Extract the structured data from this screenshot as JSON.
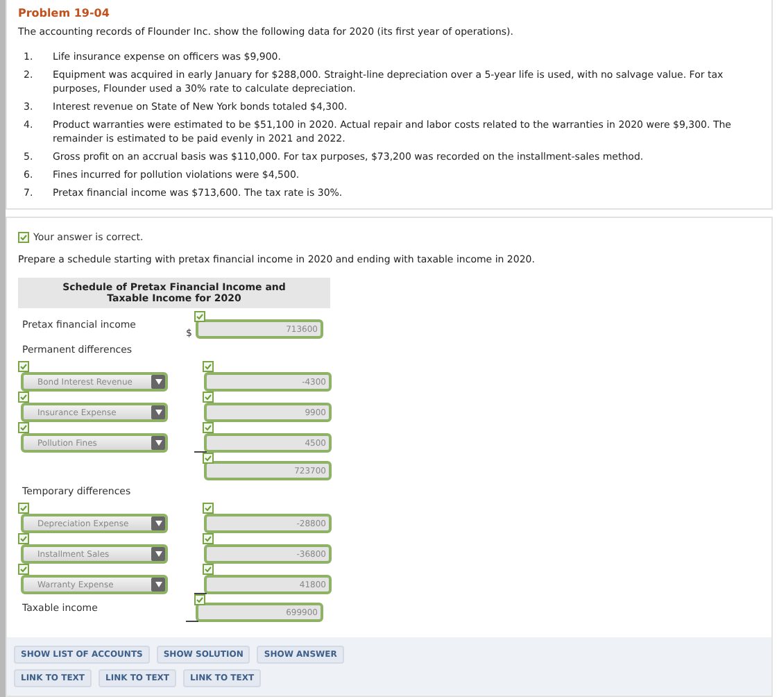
{
  "problem": {
    "title": "Problem 19-04",
    "intro": "The accounting records of Flounder Inc. show the following data for 2020 (its first year of operations).",
    "items": [
      {
        "number": "1.",
        "text": "Life insurance expense on officers was $9,900."
      },
      {
        "number": "2.",
        "text": "Equipment was acquired in early January for $288,000. Straight-line depreciation over a 5-year life is used, with no salvage value. For tax purposes, Flounder used a 30% rate to calculate depreciation."
      },
      {
        "number": "3.",
        "text": "Interest revenue on State of New York bonds totaled $4,300."
      },
      {
        "number": "4.",
        "text": "Product warranties were estimated to be $51,100 in 2020. Actual repair and labor costs related to the warranties in 2020 were $9,300. The remainder is estimated to be paid evenly in 2021 and 2022."
      },
      {
        "number": "5.",
        "text": "Gross profit on an accrual basis was $110,000. For tax purposes, $73,200 was recorded on the installment-sales method."
      },
      {
        "number": "6.",
        "text": "Fines incurred for pollution violations were $4,500."
      },
      {
        "number": "7.",
        "text": "Pretax financial income was $713,600. The tax rate is 30%."
      }
    ]
  },
  "answer": {
    "correct": true,
    "status": "Your answer is correct.",
    "instruction": "Prepare a schedule starting with pretax financial income in 2020 and ending with taxable income in 2020.",
    "schedule_title": "Schedule of Pretax Financial Income and Taxable Income for 2020",
    "rows": [
      {
        "kind": "total",
        "label": "Pretax financial income",
        "currency": "$",
        "amount": "713600",
        "correct": true,
        "underlined": false
      },
      {
        "kind": "heading",
        "label": "Permanent differences"
      },
      {
        "kind": "account",
        "account": "Bond Interest Revenue",
        "account_correct": true,
        "amount": "-4300",
        "correct": true,
        "underlined": false
      },
      {
        "kind": "account",
        "account": "Insurance Expense",
        "account_correct": true,
        "amount": "9900",
        "correct": true,
        "underlined": false
      },
      {
        "kind": "account",
        "account": "Pollution Fines",
        "account_correct": true,
        "amount": "4500",
        "correct": true,
        "underlined": true
      },
      {
        "kind": "subtotal",
        "amount": "723700",
        "correct": true,
        "underlined": false
      },
      {
        "kind": "heading",
        "label": "Temporary differences"
      },
      {
        "kind": "account",
        "account": "Depreciation Expense",
        "account_correct": true,
        "amount": "-28800",
        "correct": true,
        "underlined": false
      },
      {
        "kind": "account",
        "account": "Installment Sales",
        "account_correct": true,
        "amount": "-36800",
        "correct": true,
        "underlined": false
      },
      {
        "kind": "account",
        "account": "Warranty Expense",
        "account_correct": true,
        "amount": "41800",
        "correct": true,
        "underlined": true
      },
      {
        "kind": "total",
        "label": "Taxable income",
        "amount": "699900",
        "correct": true,
        "underlined": true
      }
    ]
  },
  "button_rows": [
    [
      "SHOW LIST OF ACCOUNTS",
      "SHOW SOLUTION",
      "SHOW ANSWER"
    ],
    [
      "LINK TO TEXT",
      "LINK TO TEXT",
      "LINK TO TEXT"
    ]
  ]
}
